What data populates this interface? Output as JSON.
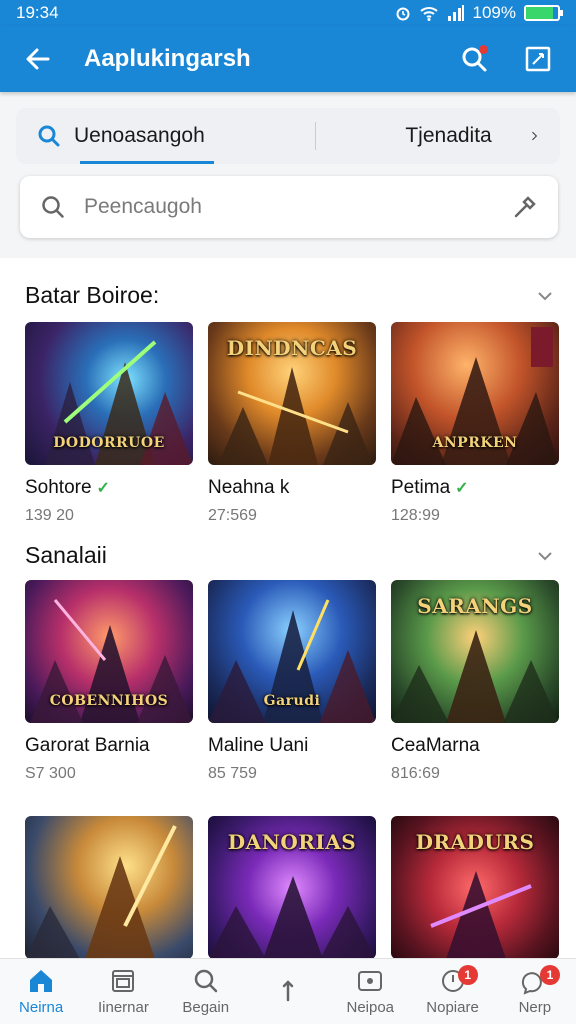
{
  "status": {
    "time": "19:34",
    "battery": "109%",
    "battery_fill": 0.85
  },
  "appbar": {
    "title": "Aaplukingarsh"
  },
  "tabs": [
    {
      "label": "Uenoasangoh"
    },
    {
      "label": "Tjenadita"
    }
  ],
  "search": {
    "placeholder": "Peencaugoh"
  },
  "sections": [
    {
      "title": "Batar Boiroe:",
      "cards": [
        {
          "name": "Sohtore",
          "price": "139 20",
          "verified": true,
          "art": "DODORRUOE"
        },
        {
          "name": "Neahna k",
          "price": "27:569",
          "verified": false,
          "art": "DINDNCAS"
        },
        {
          "name": "Petima",
          "price": "128:99",
          "verified": true,
          "art": "ANPRKEN"
        }
      ]
    },
    {
      "title": "Sanalaii",
      "cards": [
        {
          "name": "Garorat Barnia",
          "price": "S7 300",
          "verified": false,
          "art": "COBENNIHOS"
        },
        {
          "name": "Maline Uani",
          "price": "85 759",
          "verified": false,
          "art": "Garudi"
        },
        {
          "name": "CeaMarna",
          "price": "816:69",
          "verified": false,
          "art": "SARANGS"
        }
      ]
    },
    {
      "title": "",
      "cards": [
        {
          "art": ""
        },
        {
          "art": "DANORIAS"
        },
        {
          "art": "DRADURS"
        }
      ]
    }
  ],
  "nav": [
    {
      "label": "Neirna",
      "icon": "home-icon",
      "badge": ""
    },
    {
      "label": "Iinernar",
      "icon": "library-icon",
      "badge": ""
    },
    {
      "label": "Begain",
      "icon": "search-icon",
      "badge": ""
    },
    {
      "label": "",
      "icon": "arrow-up-icon",
      "badge": ""
    },
    {
      "label": "Neipoa",
      "icon": "message-icon",
      "badge": ""
    },
    {
      "label": "Nopiare",
      "icon": "notification-icon",
      "badge": "1"
    },
    {
      "label": "Nerp",
      "icon": "help-icon",
      "badge": "1"
    }
  ],
  "colors": {
    "primary": "#1a86d6",
    "badge": "#e53935",
    "verified": "#33b24a"
  }
}
